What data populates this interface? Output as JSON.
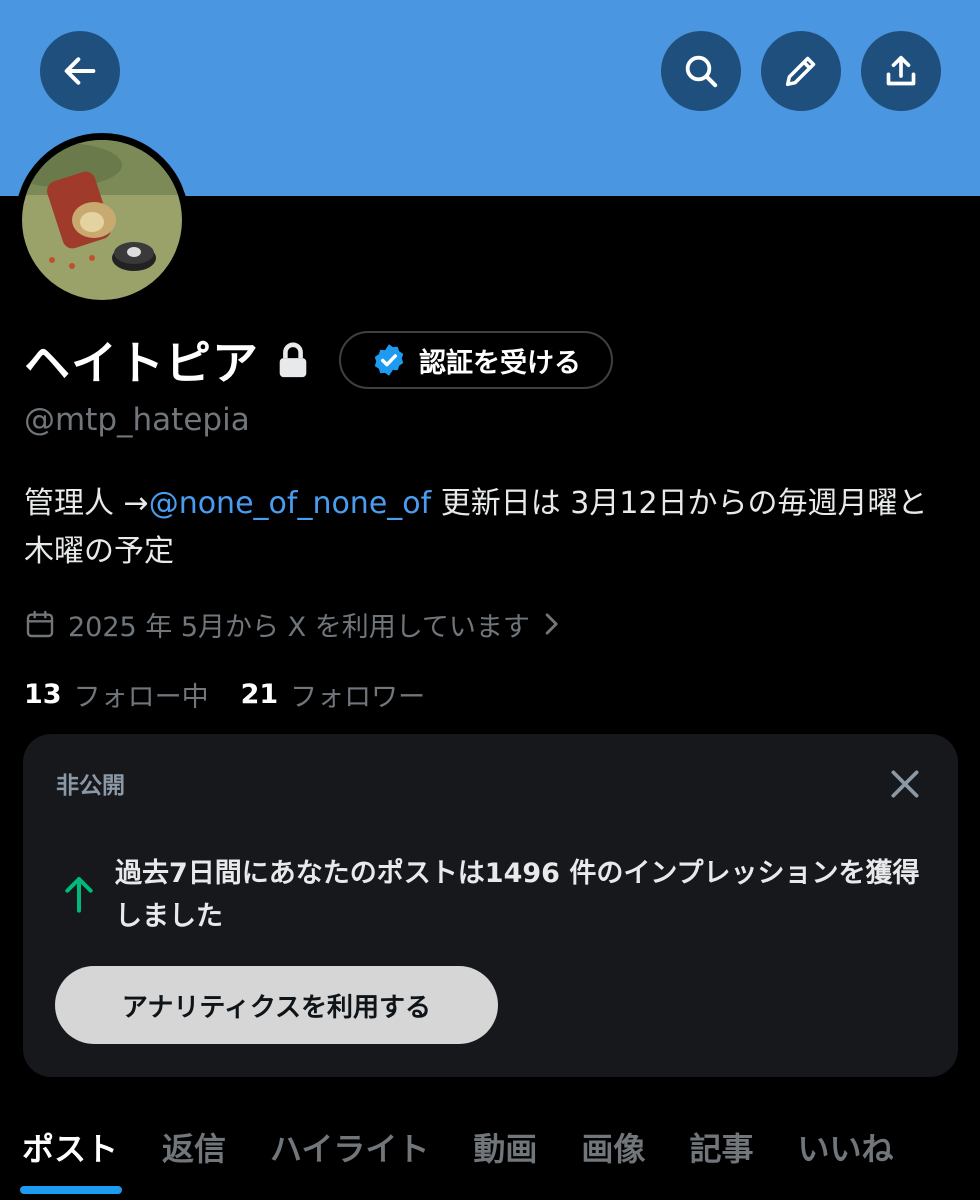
{
  "header": {
    "back_icon": "arrow-left-icon",
    "search_icon": "search-icon",
    "compose_icon": "pencil-icon",
    "share_icon": "share-icon",
    "banner_color": "#4a96e0",
    "button_color": "#1f4f7c"
  },
  "profile": {
    "display_name": "ヘイトピア",
    "lock_icon": "lock-icon",
    "verify_label": "認証を受ける",
    "handle": "@mtp_hatepia",
    "bio_prefix": "管理人 →",
    "bio_mention": "@none_of_none_of",
    "bio_suffix": " 更新日は 3月12日からの毎週月曜と木曜の予定",
    "joined": "2025 年 5月から X を利用しています",
    "following_count": "13",
    "following_label": "フォロー中",
    "followers_count": "21",
    "followers_label": "フォロワー"
  },
  "card": {
    "title": "非公開",
    "message": "過去7日間にあなたのポストは1496 件のインプレッションを獲得しました",
    "button_label": "アナリティクスを利用する",
    "arrow_color": "#00ba7c"
  },
  "tabs": [
    "ポスト",
    "返信",
    "ハイライト",
    "動画",
    "画像",
    "記事",
    "いいね"
  ],
  "accent_color": "#1d9bf0"
}
